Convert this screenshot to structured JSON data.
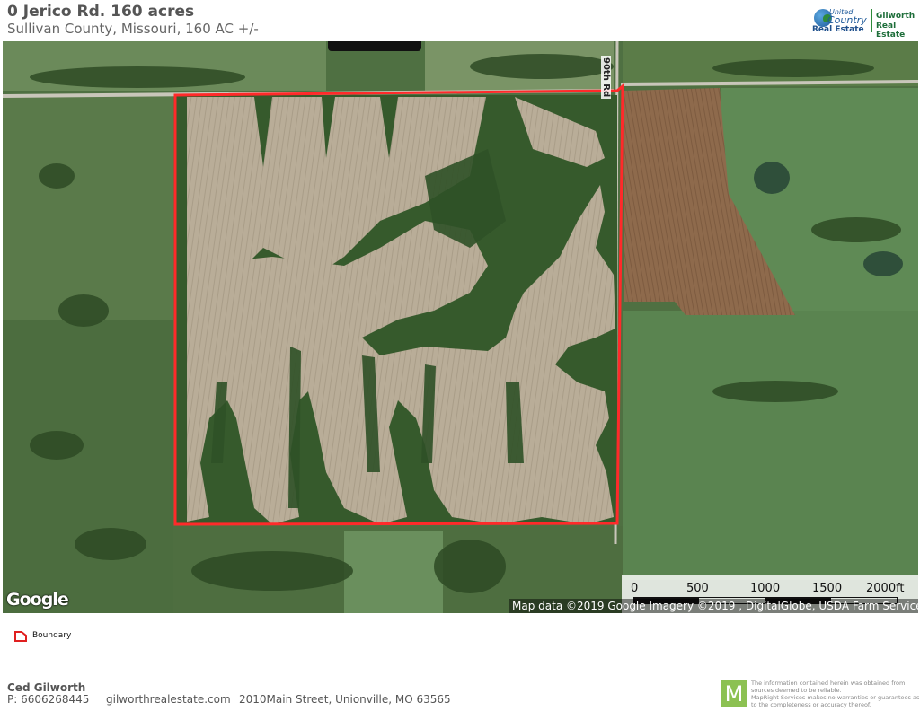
{
  "header": {
    "title": "0 Jerico Rd. 160 acres",
    "subtitle": "Sullivan County, Missouri, 160 AC +/-"
  },
  "logo": {
    "united": "United",
    "country": "Country",
    "real_estate": "Real Estate",
    "brand_line1": "Gilworth",
    "brand_line2": "Real Estate"
  },
  "map": {
    "road_label": "90th Rd",
    "google_logo": "Google",
    "attribution": "Map data ©2019 Google  Imagery ©2019 , DigitalGlobe, USDA Farm Service Agency",
    "scale": {
      "labels": [
        "0",
        "500",
        "1000",
        "1500",
        "2000ft"
      ]
    },
    "boundary_color": "#ff2a2a"
  },
  "legend": {
    "items": [
      {
        "label": "Boundary",
        "icon": "boundary-icon",
        "color": "#e02020"
      }
    ]
  },
  "footer": {
    "name": "Ced Gilworth",
    "phone": "P: 6606268445",
    "website": "gilworthrealestate.com",
    "address": "2010Main Street, Unionville, MO  63565",
    "mapright_letter": "M",
    "disclaimer": [
      "The information contained herein was obtained from",
      "sources deemed to be reliable.",
      "MapRight Services makes no warranties or guarantees as",
      "to the completeness or accuracy thereof."
    ]
  }
}
